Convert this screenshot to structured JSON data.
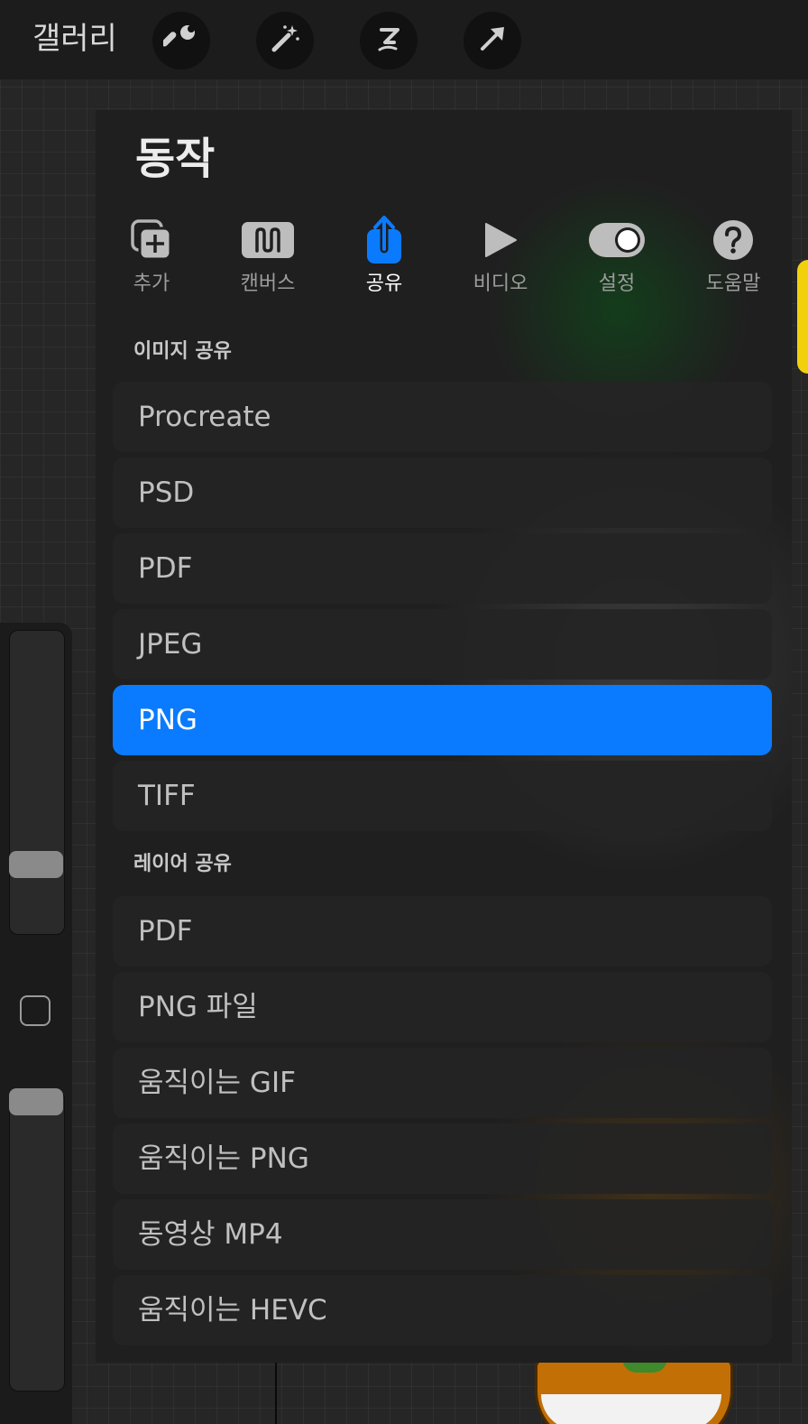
{
  "topbar": {
    "gallery_label": "갤러리",
    "tools": [
      {
        "icon": "wrench-icon",
        "name": "actions"
      },
      {
        "icon": "magic-wand-icon",
        "name": "adjustments"
      },
      {
        "icon": "selection-icon",
        "name": "selection"
      },
      {
        "icon": "transform-arrow-icon",
        "name": "transform"
      }
    ]
  },
  "panel": {
    "title": "동작",
    "tabs": [
      {
        "label": "추가",
        "icon": "add-icon",
        "active": false
      },
      {
        "label": "캔버스",
        "icon": "canvas-icon",
        "active": false
      },
      {
        "label": "공유",
        "icon": "share-icon",
        "active": true
      },
      {
        "label": "비디오",
        "icon": "play-icon",
        "active": false
      },
      {
        "label": "설정",
        "icon": "toggle-icon",
        "active": false
      },
      {
        "label": "도움말",
        "icon": "help-icon",
        "active": false
      }
    ],
    "share_image": {
      "title": "이미지 공유",
      "items": [
        "Procreate",
        "PSD",
        "PDF",
        "JPEG",
        "PNG",
        "TIFF"
      ],
      "selected": "PNG"
    },
    "share_layers": {
      "title": "레이어 공유",
      "items": [
        "PDF",
        "PNG 파일",
        "움직이는 GIF",
        "움직이는 PNG",
        "동영상 MP4",
        "움직이는 HEVC"
      ]
    }
  },
  "colors": {
    "accent": "#0a7bff",
    "panel": "#1f1f1f",
    "toolbar": "#1c1c1c"
  }
}
